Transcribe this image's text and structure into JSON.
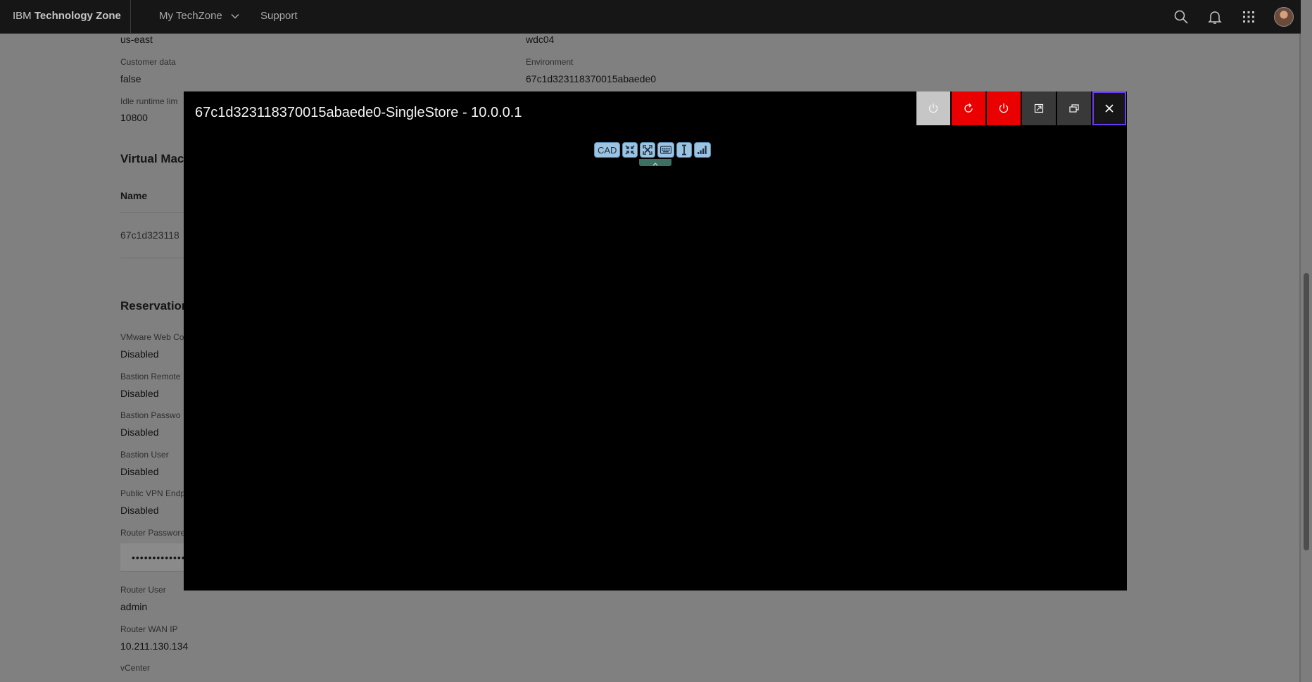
{
  "header": {
    "brand_prefix": "IBM",
    "brand_name": "Technology Zone",
    "nav": [
      {
        "label": "My TechZone"
      },
      {
        "label": "Support"
      }
    ]
  },
  "details": {
    "region_value": "us-east",
    "datacenter_value": "wdc04",
    "customer_data": {
      "label": "Customer data",
      "value": "false"
    },
    "environment": {
      "label": "Environment",
      "value": "67c1d323118370015abaede0"
    },
    "idle_runtime": {
      "label": "Idle runtime lim",
      "value": "10800"
    }
  },
  "vm_section": {
    "title": "Virtual Mach",
    "column_name": "Name",
    "row_name": "67c1d323118"
  },
  "reservation": {
    "title": "Reservation",
    "items": [
      {
        "label": "VMware Web Co",
        "value": "Disabled"
      },
      {
        "label": "Bastion Remote",
        "value": "Disabled"
      },
      {
        "label": "Bastion Passwo",
        "value": "Disabled"
      },
      {
        "label": "Bastion User",
        "value": "Disabled"
      },
      {
        "label": "Public VPN Endp",
        "value": "Disabled"
      }
    ],
    "router_password": {
      "label": "Router Passwore",
      "value": "•••••••••••••"
    },
    "router_user": {
      "label": "Router User",
      "value": "admin"
    },
    "router_wan_ip": {
      "label": "Router WAN IP",
      "value": "10.211.130.134"
    },
    "vcenter": {
      "label": "vCenter"
    }
  },
  "console": {
    "title": "67c1d323118370015abaede0-SingleStore - 10.0.0.1",
    "novnc_cad": "CAD"
  },
  "colors": {
    "header_bg": "#161616",
    "overlay_bg": "#808080",
    "danger_red": "#ea0000",
    "focus_purple": "#6c3cf0",
    "novnc_blue": "#9cc3e0"
  }
}
